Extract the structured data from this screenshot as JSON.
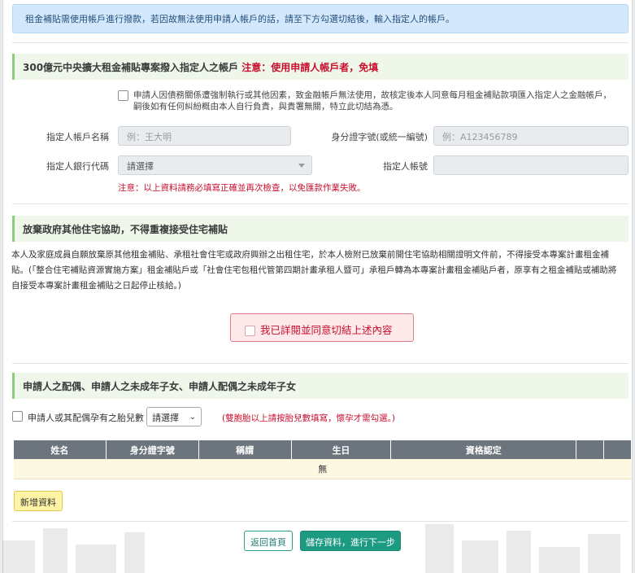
{
  "alert_text": "租金補貼需使用帳戶進行撥款，若因故無法使用申請人帳戶的話，請至下方勾選切結後，輸入指定人的帳戶。",
  "designee_section": {
    "title": "300億元中央擴大租金補貼專案撥入指定人之帳戶",
    "warning": "注意：使用申請人帳戶者，免填",
    "consent_text_line1": "申請人因債務關係遭強制執行或其他因素，致金融帳戶無法使用，故核定後本人同意每月租金補貼款項匯入指定人之金融帳戶，",
    "consent_text_line2": "嗣後如有任何糾紛概由本人自行負責，與貴署無關，特立此切結為憑。",
    "account_name_label": "指定人帳戶名稱",
    "account_name_placeholder": "例：王大明",
    "id_label": "身分證字號(或統一編號)",
    "id_placeholder": "例：A123456789",
    "bank_code_label": "指定人銀行代碼",
    "bank_code_value": "請選擇",
    "account_no_label": "指定人帳號",
    "account_no_value": "",
    "note": "注意：以上資料請務必填寫正確並再次檢查，以免匯款作業失敗。"
  },
  "waiver_section": {
    "title": "放棄政府其他住宅協助，不得重複接受住宅補貼",
    "paragraph_line1": "本人及家庭成員自願放棄原其他租金補貼、承租社會住宅或政府興辦之出租住宅，於本人檢附已放棄前開住宅協助相關證明文件前，不得接受本專案計畫租金補",
    "paragraph_line2": "貼。(「整合住宅補貼資源實施方案」租金補貼戶或「社會住宅包租代管第四期計畫承租人暨可」承租戶轉為本專案計畫租金補貼戶者，原享有之租金補貼或補助將",
    "paragraph_line3": "自接受本專案計畫租金補貼之日起停止核給。)",
    "agree_label": "我已詳閱並同意切結上述內容"
  },
  "family_section": {
    "title": "申請人之配偶、申請人之未成年子女、申請人配偶之未成年子女",
    "pregnant_label": "申請人或其配偶孕有之胎兒數",
    "pregnant_select": "請選擇",
    "pregnant_hint": "(雙胞胎以上請按胎兒數填寫，懷孕才需勾選。)",
    "table_headers": [
      "姓名",
      "身分證字號",
      "稱謂",
      "生日",
      "資格認定",
      "",
      ""
    ],
    "empty_text": "無",
    "add_button": "新增資料"
  },
  "footer": {
    "back_button": "返回首頁",
    "save_button": "儲存資料，進行下一步"
  },
  "colors": {
    "accent": "#1d9a82",
    "warning_red": "#c8102e",
    "section_bg": "#eef7ea",
    "alert_bg": "#d4e8fd",
    "table_header": "#6c757d"
  }
}
